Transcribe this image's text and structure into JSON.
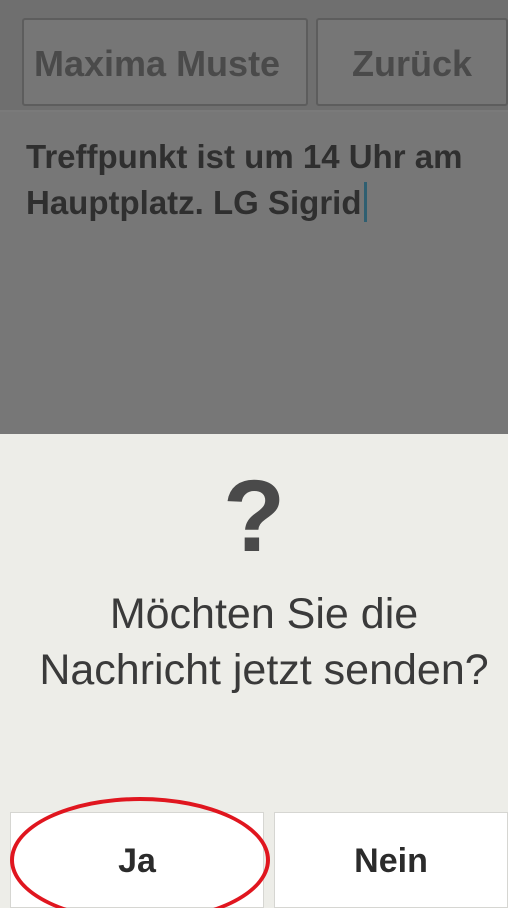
{
  "header": {
    "contact_button": "Maxima Muste",
    "back_button": "Zurück"
  },
  "message": {
    "text": "Treffpunkt ist um 14 Uhr am Hauptplatz. LG Sigrid"
  },
  "dialog": {
    "icon": "?",
    "icon_name": "question-mark-icon",
    "prompt": "Möchten Sie die Nachricht jetzt senden?",
    "yes_label": "Ja",
    "no_label": "Nein"
  },
  "annotation": {
    "highlight_color": "#e0161f",
    "highlight_target": "yes-button"
  }
}
